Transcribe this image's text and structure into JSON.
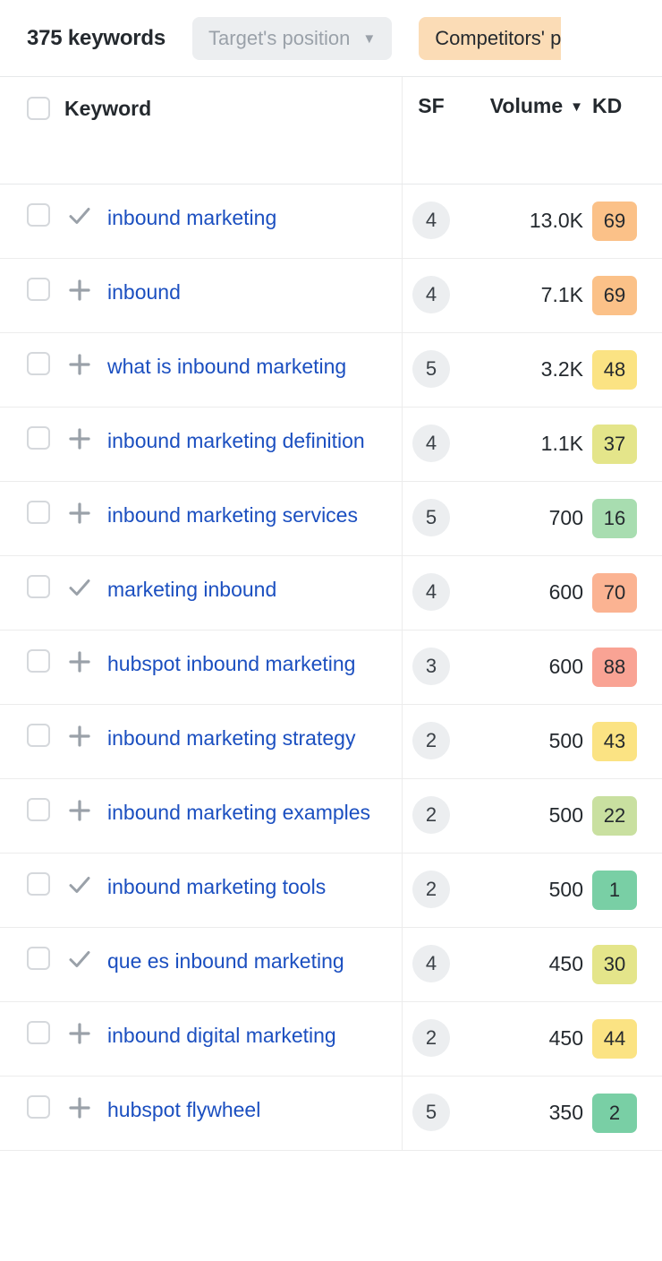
{
  "toolbar": {
    "keyword_count_label": "375 keywords",
    "target_position_filter": "Target's position",
    "target_position_caret": "▼",
    "competitors_filter": "Competitors' p"
  },
  "table": {
    "columns": {
      "keyword": "Keyword",
      "sf": "SF",
      "volume": "Volume",
      "volume_sort_caret": "▼",
      "kd": "KD"
    },
    "rows": [
      {
        "keyword": "inbound marketing",
        "status_icon": "check-icon",
        "sf": "4",
        "volume": "13.0K",
        "kd": "69",
        "kd_color": "#fbc188"
      },
      {
        "keyword": "inbound",
        "status_icon": "plus-icon",
        "sf": "4",
        "volume": "7.1K",
        "kd": "69",
        "kd_color": "#fbc188"
      },
      {
        "keyword": "what is inbound marketing",
        "status_icon": "plus-icon",
        "sf": "5",
        "volume": "3.2K",
        "kd": "48",
        "kd_color": "#fbe383"
      },
      {
        "keyword": "inbound marketing definition",
        "status_icon": "plus-icon",
        "sf": "4",
        "volume": "1.1K",
        "kd": "37",
        "kd_color": "#e4e58a"
      },
      {
        "keyword": "inbound marketing services",
        "status_icon": "plus-icon",
        "sf": "5",
        "volume": "700",
        "kd": "16",
        "kd_color": "#a8ddb0"
      },
      {
        "keyword": "marketing inbound",
        "status_icon": "check-icon",
        "sf": "4",
        "volume": "600",
        "kd": "70",
        "kd_color": "#fbb392"
      },
      {
        "keyword": "hubspot inbound marketing",
        "status_icon": "plus-icon",
        "sf": "3",
        "volume": "600",
        "kd": "88",
        "kd_color": "#f9a394"
      },
      {
        "keyword": "inbound marketing strategy",
        "status_icon": "plus-icon",
        "sf": "2",
        "volume": "500",
        "kd": "43",
        "kd_color": "#fbe383"
      },
      {
        "keyword": "inbound marketing examples",
        "status_icon": "plus-icon",
        "sf": "2",
        "volume": "500",
        "kd": "22",
        "kd_color": "#c9e0a0"
      },
      {
        "keyword": "inbound marketing tools",
        "status_icon": "check-icon",
        "sf": "2",
        "volume": "500",
        "kd": "1",
        "kd_color": "#79cfa5"
      },
      {
        "keyword": "que es inbound marketing",
        "status_icon": "check-icon",
        "sf": "4",
        "volume": "450",
        "kd": "30",
        "kd_color": "#e4e58a"
      },
      {
        "keyword": "inbound digital marketing",
        "status_icon": "plus-icon",
        "sf": "2",
        "volume": "450",
        "kd": "44",
        "kd_color": "#fbe383"
      },
      {
        "keyword": "hubspot flywheel",
        "status_icon": "plus-icon",
        "sf": "5",
        "volume": "350",
        "kd": "2",
        "kd_color": "#79cfa5"
      }
    ]
  },
  "colors": {
    "link": "#1b4fc0",
    "accent_orange": "#fbdcb6",
    "divider": "#ececec",
    "bubble_grey": "#eceef0"
  }
}
